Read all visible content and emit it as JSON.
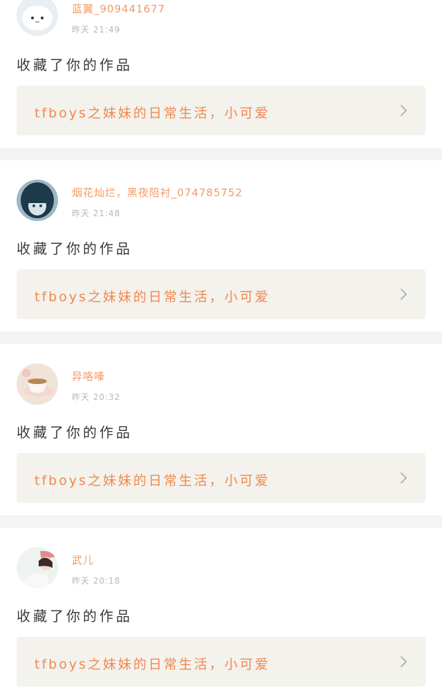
{
  "feed": {
    "items": [
      {
        "username": "蓝翼_909441677",
        "time": "昨天 21:49",
        "action": "收藏了你的作品",
        "work_title": "tfboys之妹妹的日常生活，小可爱",
        "avatar_icon": "white-bun-avatar-icon"
      },
      {
        "username": "烟花灿烂，黑夜陪衬_074785752",
        "time": "昨天 21:48",
        "action": "收藏了你的作品",
        "work_title": "tfboys之妹妹的日常生活，小可爱",
        "avatar_icon": "dark-hair-girl-avatar-icon"
      },
      {
        "username": "异咯嗪",
        "time": "昨天 20:32",
        "action": "收藏了你的作品",
        "work_title": "tfboys之妹妹的日常生活，小可爱",
        "avatar_icon": "teacup-avatar-icon"
      },
      {
        "username": "武儿",
        "time": "昨天 20:18",
        "action": "收藏了你的作品",
        "work_title": "tfboys之妹妹的日常生活，小可爱",
        "avatar_icon": "girl-with-hat-avatar-icon"
      }
    ]
  },
  "colors": {
    "username": "#f39a66",
    "work_title": "#f08850",
    "card_bg": "#f3f2ec",
    "separator": "#f4f4f3"
  }
}
